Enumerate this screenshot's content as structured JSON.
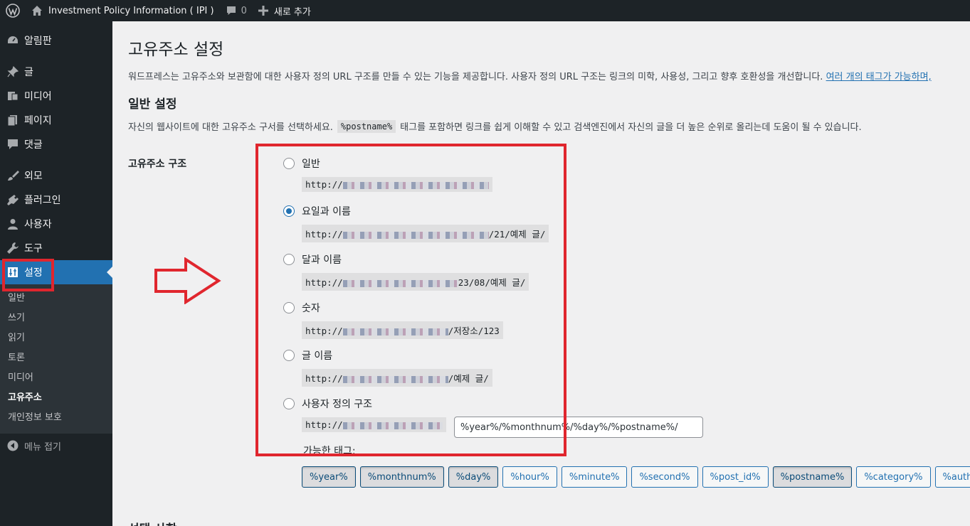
{
  "admin_bar": {
    "site_name": "Investment Policy Information ( IPI )",
    "comments_count": "0",
    "new_label": "새로 추가"
  },
  "sidebar": {
    "items": [
      {
        "label": "알림판",
        "icon": "dashboard-icon"
      },
      {
        "label": "글",
        "icon": "pin-icon"
      },
      {
        "label": "미디어",
        "icon": "media-icon"
      },
      {
        "label": "페이지",
        "icon": "page-icon"
      },
      {
        "label": "댓글",
        "icon": "comment-icon"
      },
      {
        "label": "외모",
        "icon": "brush-icon"
      },
      {
        "label": "플러그인",
        "icon": "plugin-icon"
      },
      {
        "label": "사용자",
        "icon": "user-icon"
      },
      {
        "label": "도구",
        "icon": "wrench-icon"
      },
      {
        "label": "설정",
        "icon": "settings-icon"
      }
    ],
    "submenu": [
      "일반",
      "쓰기",
      "읽기",
      "토론",
      "미디어",
      "고유주소",
      "개인정보 보호"
    ],
    "collapse_label": "메뉴 접기"
  },
  "page": {
    "title": "고유주소 설정",
    "intro": "워드프레스는 고유주소와 보관함에 대한 사용자 정의 URL 구조를 만들 수 있는 기능을 제공합니다. 사용자 정의 URL 구조는 링크의 미학, 사용성, 그리고 향후 호환성을 개선합니다. ",
    "intro_link": "여러 개의 태그가 가능하며,",
    "section_title": "일반 설정",
    "section_desc_before": "자신의 웹사이트에 대한 고유주소 구서를 선택하세요.",
    "section_code": "%postname%",
    "section_desc_after": "태그를 포함하면 링크를 쉽게 이해할 수 있고 검색엔진에서 자신의 글을 더 높은 순위로 올리는데 도움이 될 수 있습니다.",
    "row_label": "고유주소 구조",
    "options": [
      {
        "label": "일반",
        "prefix": "http://",
        "suffix": "",
        "checked": false
      },
      {
        "label": "요일과 이름",
        "prefix": "http://",
        "suffix": "/21/예제 글/",
        "checked": true
      },
      {
        "label": "달과 이름",
        "prefix": "http://",
        "suffix": "23/08/예제 글/",
        "checked": false
      },
      {
        "label": "숫자",
        "prefix": "http://",
        "suffix": "/저장소/123",
        "checked": false
      },
      {
        "label": "글 이름",
        "prefix": "http://",
        "suffix": "/예제 글/",
        "checked": false
      },
      {
        "label": "사용자 정의 구조",
        "prefix": "http://",
        "suffix": "",
        "checked": false
      }
    ],
    "custom_value": "%year%/%monthnum%/%day%/%postname%/",
    "available_tags_label": "가능한 태그:",
    "tags": [
      {
        "label": "%year%",
        "active": true
      },
      {
        "label": "%monthnum%",
        "active": true
      },
      {
        "label": "%day%",
        "active": true
      },
      {
        "label": "%hour%",
        "active": false
      },
      {
        "label": "%minute%",
        "active": false
      },
      {
        "label": "%second%",
        "active": false
      },
      {
        "label": "%post_id%",
        "active": false
      },
      {
        "label": "%postname%",
        "active": true
      },
      {
        "label": "%category%",
        "active": false
      },
      {
        "label": "%author%",
        "active": false
      }
    ],
    "next_section_title": "선택 사항"
  },
  "colors": {
    "accent": "#2271b1",
    "admin_dark": "#1d2327",
    "annotation_red": "#e0262e"
  }
}
